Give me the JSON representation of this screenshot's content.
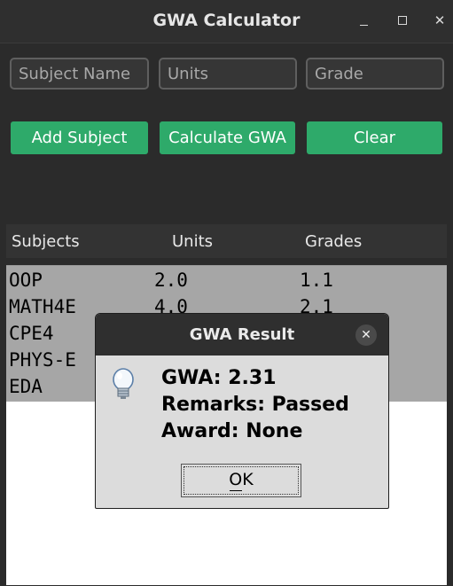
{
  "window": {
    "title": "GWA Calculator",
    "controls": [
      "minimize-icon",
      "maximize-icon",
      "close-icon"
    ]
  },
  "inputs": {
    "subject_placeholder": "Subject Name",
    "units_placeholder": "Units",
    "grade_placeholder": "Grade"
  },
  "buttons": {
    "add": "Add Subject",
    "calculate": "Calculate GWA",
    "clear": "Clear",
    "accent": "#2eaa6a"
  },
  "table": {
    "headers": [
      "Subjects",
      "Units",
      "Grades"
    ],
    "rows": [
      {
        "subject": "OOP",
        "units": "2.0",
        "grade": "1.1"
      },
      {
        "subject": "MATH4E",
        "units": "4.0",
        "grade": "2.1"
      },
      {
        "subject": "CPE4",
        "units": "",
        "grade": ""
      },
      {
        "subject": "PHYS-E",
        "units": "",
        "grade": ""
      },
      {
        "subject": "EDA",
        "units": "",
        "grade": ""
      }
    ]
  },
  "dialog": {
    "title": "GWA Result",
    "icon": "lightbulb-icon",
    "close_glyph": "✕",
    "gwa_line": "GWA: 2.31",
    "remarks_line": "Remarks: Passed",
    "award_line": "Award: None",
    "ok_label": "OK"
  }
}
